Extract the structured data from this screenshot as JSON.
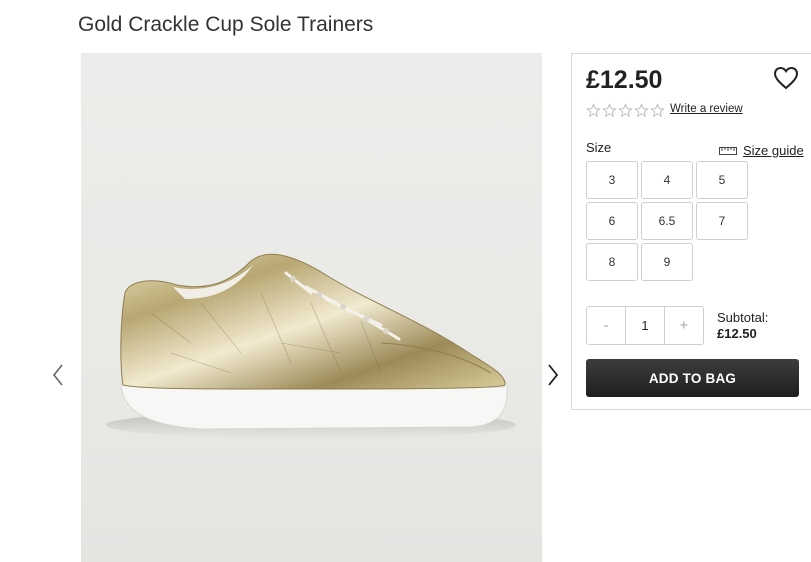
{
  "product": {
    "title": "Gold Crackle Cup Sole Trainers",
    "price": "£12.50",
    "review_link": "Write a review",
    "rating_stars": 0,
    "rating_max": 5
  },
  "size_selector": {
    "label": "Size",
    "guide_label": "Size guide",
    "options": [
      "3",
      "4",
      "5",
      "6",
      "6.5",
      "7",
      "8",
      "9"
    ]
  },
  "quantity": {
    "decrement": "-",
    "value": "1",
    "increment": "+"
  },
  "subtotal": {
    "label": "Subtotal:",
    "amount": "£12.50"
  },
  "actions": {
    "add_to_bag": "ADD TO BAG"
  },
  "icons": {
    "prev": "chevron-left-icon",
    "next": "chevron-right-icon",
    "wishlist": "heart-icon",
    "star": "star-outline-icon",
    "ruler": "ruler-icon"
  },
  "colors": {
    "button_dark": "#262626",
    "border": "#cfcfcf",
    "text": "#222222"
  }
}
